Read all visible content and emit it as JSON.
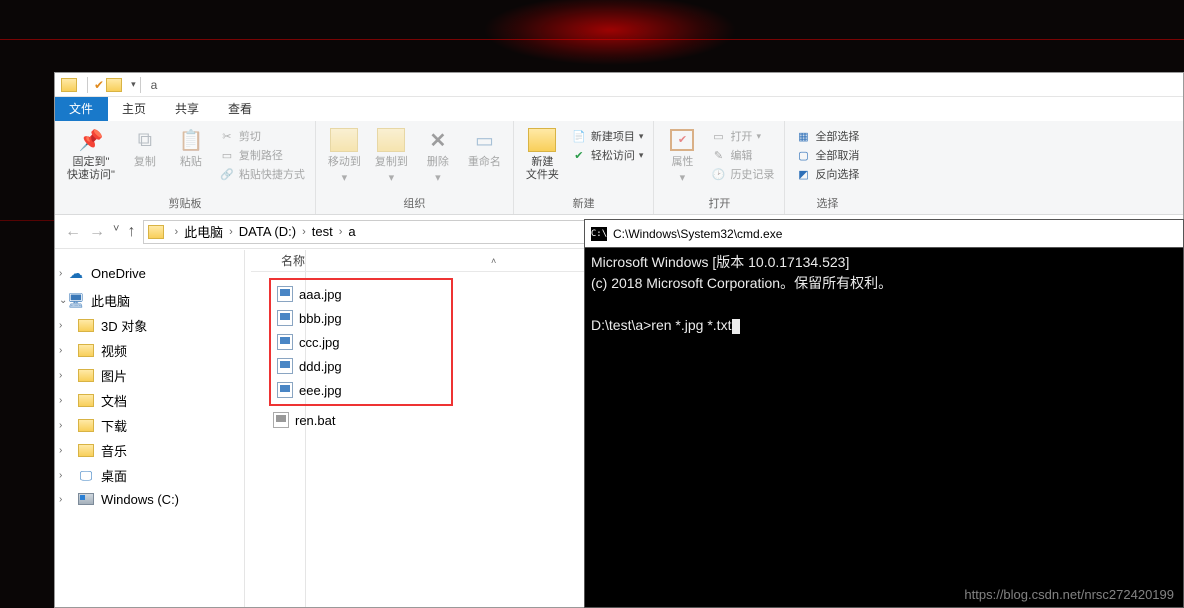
{
  "qat": {
    "title": "a"
  },
  "tabs": {
    "file": "文件",
    "home": "主页",
    "share": "共享",
    "view": "查看"
  },
  "ribbon": {
    "pin": "固定到\"\n快速访问\"",
    "copy": "复制",
    "paste": "粘贴",
    "cut": "剪切",
    "copypath": "复制路径",
    "pastelink": "粘贴快捷方式",
    "clipboard_grp": "剪贴板",
    "moveto": "移动到",
    "copyto": "复制到",
    "delete": "删除",
    "rename": "重命名",
    "organize_grp": "组织",
    "newfolder": "新建\n文件夹",
    "newitem": "新建项目",
    "easyaccess": "轻松访问",
    "new_grp": "新建",
    "properties": "属性",
    "open": "打开",
    "edit": "编辑",
    "history": "历史记录",
    "open_grp": "打开",
    "selectall": "全部选择",
    "selectnone": "全部取消",
    "invert": "反向选择",
    "select_grp": "选择"
  },
  "address": {
    "crumbs": [
      "此电脑",
      "DATA (D:)",
      "test",
      "a"
    ]
  },
  "sidebar": {
    "onedrive": "OneDrive",
    "thispc": "此电脑",
    "items": [
      "3D 对象",
      "视频",
      "图片",
      "文档",
      "下载",
      "音乐",
      "桌面",
      "Windows (C:)"
    ]
  },
  "columns": {
    "name": "名称"
  },
  "files": {
    "highlighted": [
      "aaa.jpg",
      "bbb.jpg",
      "ccc.jpg",
      "ddd.jpg",
      "eee.jpg"
    ],
    "other": [
      "ren.bat"
    ]
  },
  "cmd": {
    "title": "C:\\Windows\\System32\\cmd.exe",
    "lines": [
      "Microsoft Windows [版本 10.0.17134.523]",
      "(c) 2018 Microsoft Corporation。保留所有权利。",
      "",
      "D:\\test\\a>ren *.jpg *.txt"
    ]
  },
  "watermark": "https://blog.csdn.net/nrsc272420199"
}
